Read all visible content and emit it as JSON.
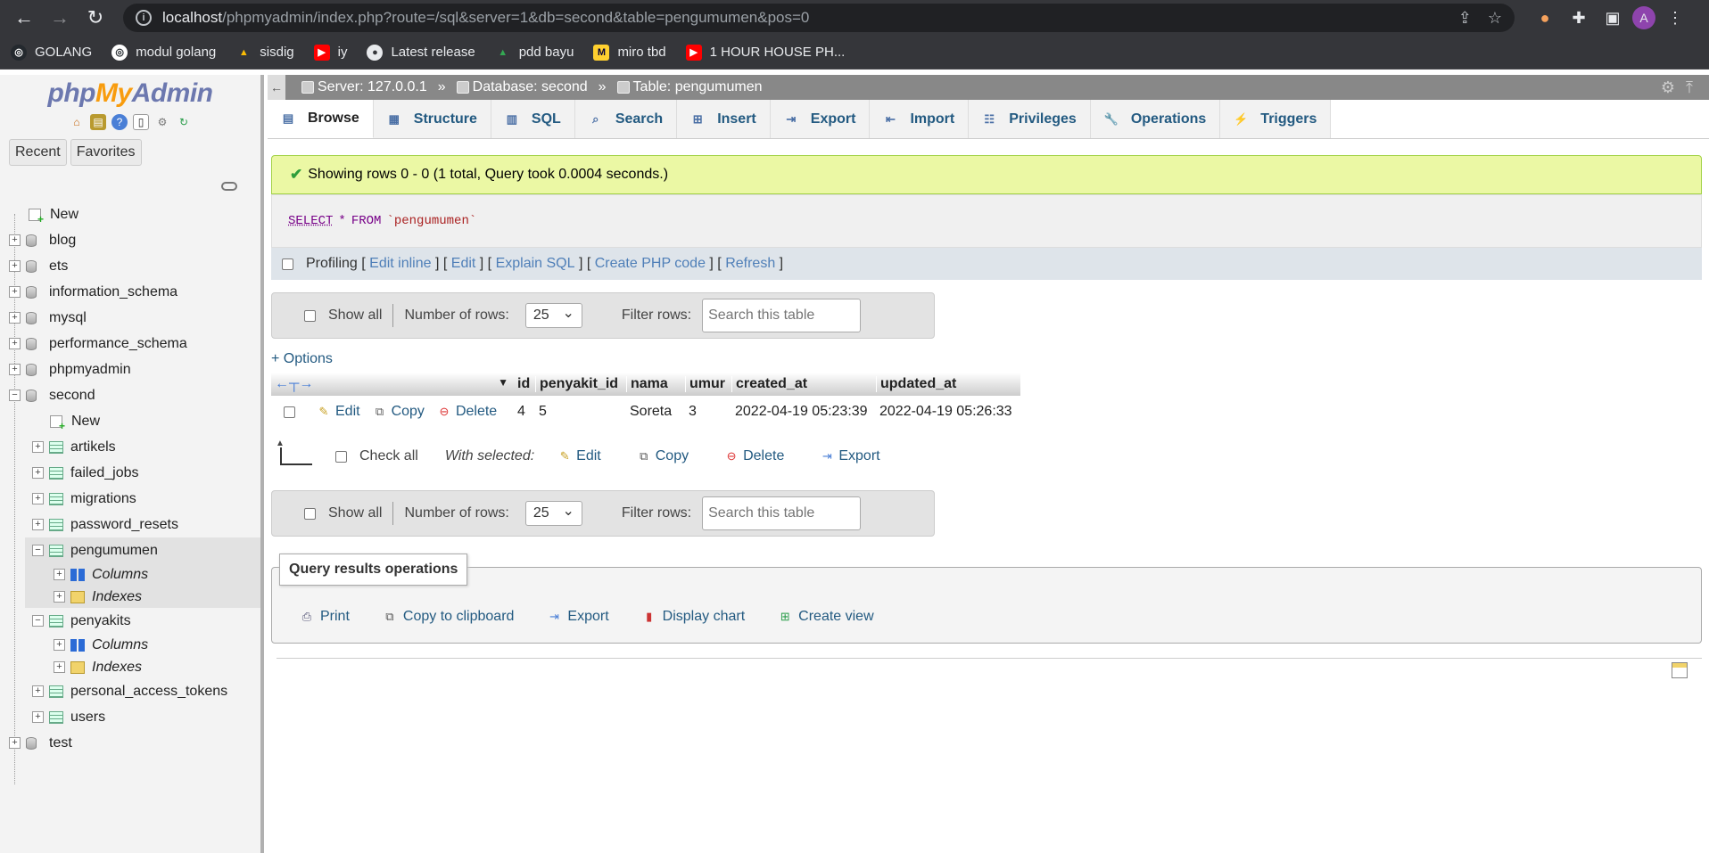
{
  "browser": {
    "url_host": "localhost",
    "url_path": "/phpmyadmin/index.php?route=/sql&server=1&db=second&table=pengumumen&pos=0",
    "profile_initial": "A",
    "bookmarks": [
      "GOLANG",
      "modul golang",
      "sisdig",
      "iy",
      "Latest release",
      "pdd bayu",
      "miro tbd",
      "1 HOUR HOUSE PH..."
    ]
  },
  "sidebar": {
    "logo_php": "php",
    "logo_my": "My",
    "logo_admin": "Admin",
    "recent": "Recent",
    "favorites": "Favorites",
    "new": "New",
    "databases": [
      "blog",
      "ets",
      "information_schema",
      "mysql",
      "performance_schema",
      "phpmyadmin",
      "second"
    ],
    "second_new": "New",
    "tables_before": [
      "artikels",
      "failed_jobs",
      "migrations",
      "password_resets"
    ],
    "selected_table": "pengumumen",
    "columns": "Columns",
    "indexes": "Indexes",
    "penyakits": "penyakits",
    "tables_after": [
      "personal_access_tokens",
      "users"
    ],
    "last_db": "test"
  },
  "breadcrumb": {
    "server": "Server: 127.0.0.1",
    "database": "Database: second",
    "table": "Table: pengumumen",
    "sep": "»"
  },
  "tabs": [
    "Browse",
    "Structure",
    "SQL",
    "Search",
    "Insert",
    "Export",
    "Import",
    "Privileges",
    "Operations",
    "Triggers"
  ],
  "message": "Showing rows 0 - 0 (1 total, Query took 0.0004 seconds.)",
  "sql": {
    "select": "SELECT",
    "star": "*",
    "from": "FROM",
    "table": "`pengumumen`"
  },
  "profiling": {
    "label": "Profiling",
    "links": [
      "Edit inline",
      "Edit",
      "Explain SQL",
      "Create PHP code",
      "Refresh"
    ]
  },
  "nav": {
    "show_all": "Show all",
    "num_rows_label": "Number of rows:",
    "num_rows": "25",
    "filter_label": "Filter rows:",
    "filter_placeholder": "Search this table"
  },
  "options": "+ Options",
  "table": {
    "columns": [
      "id",
      "penyakit_id",
      "nama",
      "umur",
      "created_at",
      "updated_at"
    ],
    "actions": [
      "Edit",
      "Copy",
      "Delete"
    ],
    "rows": [
      [
        "4",
        "5",
        "Soreta",
        "3",
        "2022-04-19 05:23:39",
        "2022-04-19 05:26:33"
      ]
    ]
  },
  "bulk": {
    "check_all": "Check all",
    "with_selected": "With selected:",
    "actions": [
      "Edit",
      "Copy",
      "Delete",
      "Export"
    ]
  },
  "qro": {
    "title": "Query results operations",
    "links": [
      "Print",
      "Copy to clipboard",
      "Export",
      "Display chart",
      "Create view"
    ]
  },
  "colors": {
    "link": "#235a81",
    "success_bg": "#ebf8a4",
    "logo_blue": "#6c78af",
    "logo_orange": "#f89c0e"
  }
}
